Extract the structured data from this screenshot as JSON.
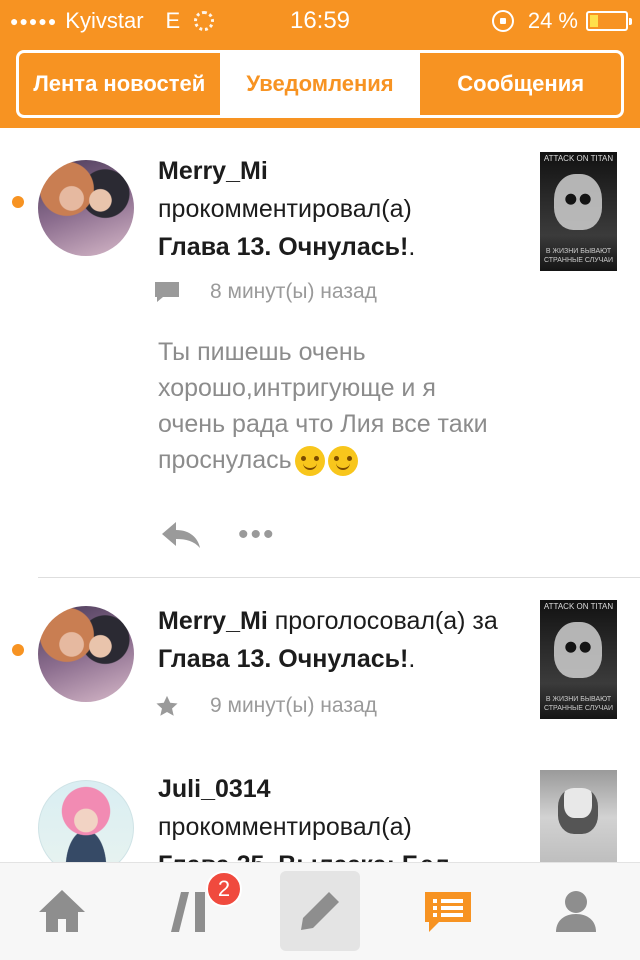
{
  "status_bar": {
    "carrier": "Kyivstar",
    "network": "E",
    "time": "16:59",
    "battery_text": "24 %",
    "battery_level": 0.24
  },
  "tabs": [
    {
      "label": "Лента новостей",
      "active": false
    },
    {
      "label": "Уведомления",
      "active": true
    },
    {
      "label": "Сообщения",
      "active": false
    }
  ],
  "notifications": [
    {
      "user": "Merry_Mi",
      "action": "прокомментировал(а)",
      "target": "Глава 13. Очнулась!",
      "suffix": ".",
      "time_ago": "8 минут(ы) назад",
      "comment": "Ты пишешь очень хорошо,интригующе и я очень рада что Лия все таки проснулась",
      "unread": true,
      "icon": "comment-icon",
      "cover_title": "ATTACK ON TITAN",
      "cover_caption": "В ЖИЗНИ БЫВАЮТ СТРАННЫЕ СЛУЧАИ"
    },
    {
      "user": "Merry_Mi",
      "action": "проголосовал(а) за",
      "target": "Глава 13. Очнулась!",
      "suffix": ".",
      "time_ago": "9 минут(ы) назад",
      "unread": true,
      "icon": "star-icon",
      "cover_title": "ATTACK ON TITAN",
      "cover_caption": "В ЖИЗНИ БЫВАЮТ СТРАННЫЕ СЛУЧАИ"
    },
    {
      "user": "Juli_0314",
      "action": "прокомментировал(а)",
      "target": "Глава 25. Вылазка: Бел",
      "unread": false
    }
  ],
  "tabbar": {
    "library_badge": "2",
    "active": "notifications",
    "icons": [
      "home-icon",
      "library-icon",
      "pencil-icon",
      "notifications-icon",
      "profile-icon"
    ],
    "accent": "#f79322",
    "inactive": "#8e8e8e"
  }
}
